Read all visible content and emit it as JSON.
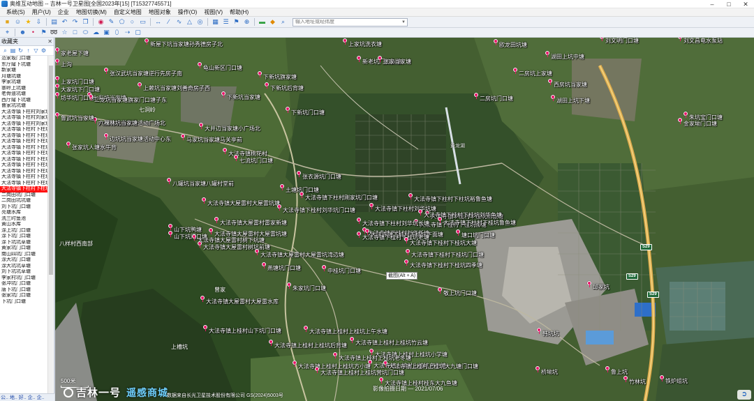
{
  "window": {
    "title": "奥维互动地图 -- 吉林一号卫星图[全国2023年[15] [T15327745571]"
  },
  "menu": [
    "系统(S)",
    "用户(U)",
    "企业",
    "地图切换(M)",
    "自定义地图",
    "地图对象",
    "操作(O)",
    "视图(V)",
    "帮助(H)"
  ],
  "search": {
    "placeholder": "输入地址或经纬度"
  },
  "left_panel": {
    "title": "收藏夹",
    "items": [
      "范家坂门口塘",
      "东厅窿下坑塘",
      "新家塘",
      "月塘坑塘",
      "李家坑塘",
      "寨岭上坑塘",
      "老骨道坑塘",
      "西厅窿下坑塘",
      "曹家坑坑塘",
      "大法寺镇下柱村刘家坊",
      "大法寺镇下柱村刘家坊",
      "大法寺镇下柱村刘家坊",
      "大法寺镇下柱村下柱坊",
      "大法寺镇下柱村下柱坊",
      "大法寺镇下柱村下柱坊",
      "大法寺镇下柱村下柱坊",
      "大法寺镇下柱村下柱坊",
      "大法寺镇下柱村下柱坊",
      "大法寺镇下柱村下柱坊",
      "大法寺镇下柱村下柱坊",
      "大法寺镇下柱村下柱坊",
      "大法寺镇下柱村下柱坊",
      "大法寺镇下柱村下柱坊",
      "二岗田坑门口塘",
      "二岗田坑坑塘",
      "刘下坑门口塘",
      "亮塘水库",
      "洗三时鱼池",
      "黄山水库",
      "涂上坑门口塘",
      "涂下坑门口塘",
      "涂下坑坑草塘",
      "黄家坑门口塘",
      "南山四坑门口塘",
      "涂大坑门口塘",
      "涂大坑坑草塘",
      "刘下坑坑草塘",
      "李家村坑门口塘",
      "张冲坑门口塘",
      "唐下坑门口塘",
      "张家坑门口塘",
      "下坑门口塘"
    ],
    "tabs": [
      "公..",
      "地..",
      "好..",
      "企..",
      "企.."
    ]
  },
  "map": {
    "tooltip": "截图(Alt + A)",
    "scale": "500米",
    "brand_name": "吉林一号",
    "brand_sub": "遥感商城",
    "credit": "数据来自长光卫星技术股份有限公司 GS(2024)5003号",
    "image_date": "影像拍摄日期 — 2021/07/06",
    "road_shields": [
      "S29",
      "S29",
      "S29"
    ],
    "road_names": [
      "黄龙湖"
    ],
    "area_labels": [
      "曾家",
      "上槽坑",
      "七洞岭",
      "八样村西南部"
    ],
    "pois": [
      "新屋下坑当家塘孙秀德房子北",
      "家老屋下塘",
      "上沟",
      "上家坑洗衣塘",
      "新老坑门口鱼塘",
      "张家当家塘",
      "欧龙田坑塘",
      "刘文明门口塘",
      "刘文昌电水泵站",
      "张汉武坑当家塘逆行先房子南",
      "龟山新区门口塘",
      "下新坑旗家塘",
      "二房坑上家塘",
      "湖田上坑中塘",
      "上家坑门口塘",
      "大家坑下门口塘",
      "上赖坑当家塘刘善奇房子西",
      "下新坑后背塘",
      "西房坑当家塘",
      "湖田上坑下塘",
      "坊华坑门口塘",
      "下新坑当家塘",
      "二房坑门口塘",
      "七彩坑当家塘",
      "二龙坑当家塘旗家门口塘子东",
      "下新坑门口塘",
      "金家坳门口塘",
      "朱坑宝门口塘",
      "六桐坑坑当家塘",
      "大井边当家塘小广场北",
      "八裸林坑当家塘活动广场北",
      "鲁武坑当家塘",
      "边坑坑当家塘活动中心东",
      "马家坑当家塘马关亭前",
      "大法寺镇桃花村",
      "张家坑人塘水牛背",
      "七流坑门口塘",
      "张衣源坑门口塘",
      "八罐坑当家塘八罐村堂前",
      "土塘坑门口塘",
      "大法寺镇下柱村刚家坑门口塘",
      "大法寺镇大屋雷村大屋雷坑塘",
      "大法寺镇下桂村刘华坑门口塘",
      "大法寺镇下柱村刘华坑塘",
      "大法寺镇下柱村下柱坑裕鲁鱼塘",
      "大法寺镇下桂村下桂坑新张塘",
      "大法寺镇下桂村下桂坑柳塘",
      "大法寺镇大屋雷村雷家新塘",
      "山下坑鸭塘",
      "大法寺镇大屋雷村大屋雷坑塘",
      "大法寺镇下桂村刘华新塘",
      "大法寺镇下柱村刘华坑长塘",
      "大法寺镇下桂村下桂坑刘华鱼塘",
      "大法寺镇下柱村下桂坑鲁鱼塘",
      "山下坑门口塘",
      "大法寺镇大屋雷村树下坑塘",
      "大法寺镇下桂村下桂坑下面塘",
      "大法寺镇下桂村下桂坑老塘",
      "大法寺镇大屋雷村树坑前塘",
      "大法寺镇下桂村下桂坑大塘",
      "塘口坑门口塘",
      "大法寺镇大屋雷村大屋雷坑湾边塘",
      "大法寺镇下桂村下桂坑门口塘",
      "大法寺镇下桂村下桂坑四季塘",
      "燕塘坑门口塘",
      "中桂坑门口塘",
      "朱家坑门口塘",
      "邱家坑",
      "敬上坑门口塘",
      "大法寺镇大屋雷村大屋雷水库",
      "大法寺镇上桂村山下坑门口塘",
      "大法寺镇上桂村上桂坑上午水塘",
      "大法寺镇上桂村上桂坑竹云塘",
      "大法寺镇上桂村上桂坑后背塘",
      "大法寺镇上桂村上桂坑小学塘",
      "大法寺镇上桂村上桂坑老冬塘",
      "大法寺镇上桂村上桂坑老生塘",
      "大法寺镇上桂村上桂坑方小塘",
      "大法寺镇上桂村上桂坑大九塘门口塘",
      "大法寺镇上桂村上桂坑营坑门口塘",
      "大法寺镇上桂村桂东大九鱼塘",
      "韩坑坑",
      "桥坳坑",
      "鲁上坑",
      "竹林坑",
      "铁炉组坑"
    ]
  }
}
